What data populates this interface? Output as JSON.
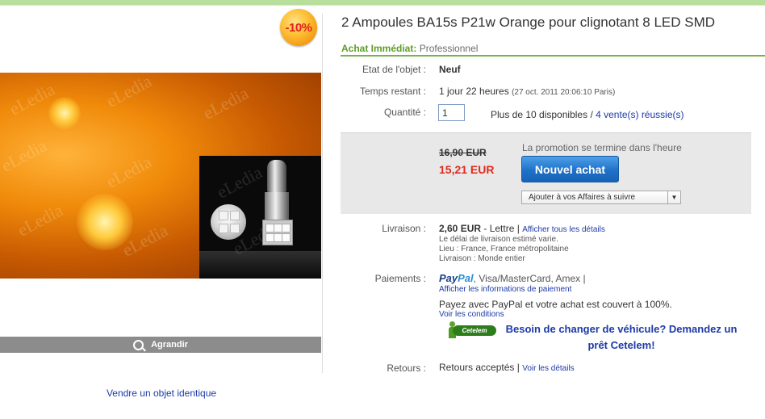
{
  "item": {
    "title": "2 Ampoules BA15s P21w Orange pour clignotant 8 LED SMD",
    "discount_badge": "-10%",
    "enlarge_label": "Agrandir",
    "sell_same_label": "Vendre un objet identique",
    "watermark_text": "eLedia"
  },
  "buy_format": {
    "label": "Achat Immédiat:",
    "seller_type": "Professionnel"
  },
  "details": {
    "condition": {
      "label": "Etat de l'objet :",
      "value": "Neuf"
    },
    "time_left": {
      "label": "Temps restant :",
      "value": "1 jour 22 heures",
      "date": "(27 oct. 2011 20:06:10 Paris)"
    },
    "quantity": {
      "label": "Quantité :",
      "value": "1",
      "available": "Plus de 10 disponibles",
      "sep": "/",
      "sold_link": "4 vente(s) réussie(s)"
    }
  },
  "price": {
    "old": "16,90 EUR",
    "new": "15,21 EUR",
    "promo_note": "La promotion se termine dans l'heure",
    "buy_button": "Nouvel achat",
    "watch_select": "Ajouter à vos Affaires à suivre"
  },
  "shipping": {
    "label": "Livraison :",
    "price": "2,60 EUR",
    "method": "- Lettre",
    "sep": "|",
    "details_link": "Afficher tous les détails",
    "delay": "Le délai de livraison estimé varie.",
    "location": "Lieu : France, France métropolitaine",
    "ships_to": "Livraison : Monde entier"
  },
  "payments": {
    "label": "Paiements :",
    "paypal_1": "Pay",
    "paypal_2": "Pal",
    "methods": ", Visa/MasterCard, Amex |",
    "info_link": "Afficher les informations de paiement",
    "coverage": "Payez avec PayPal et votre achat est couvert à 100%.",
    "conditions_link": "Voir les conditions",
    "cetelem_logo": "Cetelem",
    "cetelem_line1": "Besoin de changer de véhicule? Demandez un",
    "cetelem_line2": "prêt Cetelem!"
  },
  "returns": {
    "label": "Retours :",
    "value": "Retours acceptés",
    "sep": "|",
    "details_link": "Voir les détails"
  },
  "colors": {
    "accent_green": "#78b24a",
    "link_blue": "#1c3aa8",
    "price_red": "#e22a1d",
    "button_blue": "#1f71c9"
  }
}
